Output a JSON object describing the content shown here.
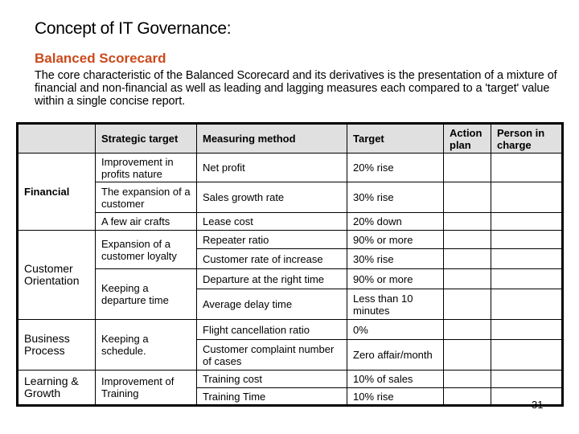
{
  "slide": {
    "title": "Concept of IT Governance:",
    "subtitle": "Balanced Scorecard",
    "description": "The core characteristic of the Balanced Scorecard and its derivatives is the presentation of a mixture of financial and non-financial as well as leading and lagging measures each compared to a 'target' value within a single concise report.",
    "accent_color": "#cc4a1c",
    "page_number": "31"
  },
  "table": {
    "headers": [
      "",
      "Strategic target",
      "Measuring method",
      "Target",
      "Action plan",
      "Person in charge"
    ],
    "perspectives": [
      {
        "name": "Financial",
        "objectives": [
          {
            "strategic_target": "Improvement in profits nature",
            "measures": [
              {
                "method": "Net profit",
                "target": "20% rise"
              }
            ]
          },
          {
            "strategic_target": "The expansion of a customer",
            "measures": [
              {
                "method": "Sales growth rate",
                "target": "30% rise"
              }
            ]
          },
          {
            "strategic_target": "A few air crafts",
            "measures": [
              {
                "method": "Lease cost",
                "target": "20% down"
              }
            ]
          }
        ]
      },
      {
        "name": "Customer Orientation",
        "objectives": [
          {
            "strategic_target": "Expansion of a customer loyalty",
            "measures": [
              {
                "method": "Repeater ratio",
                "target": "90% or more"
              },
              {
                "method": "Customer rate of increase",
                "target": "30% rise"
              }
            ]
          },
          {
            "strategic_target": "Keeping a departure time",
            "measures": [
              {
                "method": "Departure at the right time",
                "target": "90% or more"
              },
              {
                "method": "Average delay time",
                "target": "Less than 10 minutes"
              }
            ]
          }
        ]
      },
      {
        "name": "Business Process",
        "objectives": [
          {
            "strategic_target": "Keeping a schedule.",
            "measures": [
              {
                "method": "Flight cancellation ratio",
                "target": "0%"
              },
              {
                "method": "Customer complaint number of cases",
                "target": "Zero affair/month"
              }
            ]
          }
        ]
      },
      {
        "name": "Learning & Growth",
        "objectives": [
          {
            "strategic_target": "Improvement of Training",
            "measures": [
              {
                "method": "Training cost",
                "target": "10% of sales"
              },
              {
                "method": "Training Time",
                "target": "10% rise"
              }
            ]
          }
        ]
      }
    ]
  }
}
